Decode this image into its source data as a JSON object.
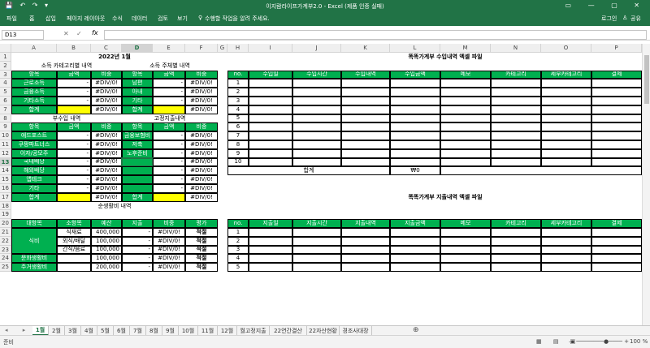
{
  "window": {
    "title": "이지람라이프가계부2.0 - Excel (제품 인증 실패)"
  },
  "ribbon": {
    "tabs": [
      "파일",
      "홈",
      "삽입",
      "페이지 레이아웃",
      "수식",
      "데이터",
      "검토",
      "보기"
    ],
    "tellme": "수행할 작업을 알려 주세요.",
    "login": "로그인",
    "share": "공유"
  },
  "formula": {
    "namebox": "D13",
    "fx": "fx",
    "value": ""
  },
  "columns": [
    "A",
    "B",
    "C",
    "D",
    "E",
    "F",
    "G",
    "H",
    "I",
    "J",
    "K",
    "L",
    "M",
    "N",
    "O",
    "P"
  ],
  "rows": [
    "1",
    "2",
    "3",
    "4",
    "5",
    "6",
    "7",
    "8",
    "9",
    "10",
    "11",
    "12",
    "13",
    "14",
    "15",
    "16",
    "17",
    "18",
    "19",
    "20",
    "21",
    "22",
    "23",
    "24",
    "25"
  ],
  "left": {
    "title": "2022년 1월",
    "sec1": "소득 카테고리별 내역",
    "sec2": "소득 주체별 내역",
    "h_item": "항목",
    "h_amt": "금액",
    "h_ratio": "비중",
    "inc_items": [
      "근로소득",
      "금융소득",
      "기타소득",
      "합계"
    ],
    "owner_items": [
      "남편",
      "아내",
      "기타",
      "합계"
    ],
    "dash": "-",
    "div": "#DIV/0!",
    "sec3": "부수입 내역",
    "sec4": "고정지출내역",
    "side_items": [
      "애드포스트",
      "쿠팡파트너스",
      "이자/공모주",
      "국내배당",
      "해외배당",
      "앱테크",
      "기타",
      "합계"
    ],
    "fixed_items": [
      "금융보험비",
      "저축",
      "노후준비"
    ],
    "sec5": "순생활비 내역",
    "h_big": "대항목",
    "h_small": "소항목",
    "h_budget": "예산",
    "h_spend": "지출",
    "h_eval": "평가",
    "living_big": [
      "식비",
      "문화생활비",
      "주거생활비"
    ],
    "living_small": [
      "식재료",
      "외식/배달",
      "간식/음료"
    ],
    "budgets": [
      "400,000",
      "100,000",
      "100,000",
      "100,000",
      "200,000"
    ],
    "eval": "적절"
  },
  "right": {
    "income_title": "똑똑가계부 수입내역 엑셀 파일",
    "income_headers": [
      "no.",
      "수입일",
      "수입시간",
      "수입내역",
      "수입금액",
      "메모",
      "카테고리",
      "세부카테고리",
      "결제"
    ],
    "nums": [
      "1",
      "2",
      "3",
      "4",
      "5",
      "6",
      "7",
      "8",
      "9",
      "10"
    ],
    "total_label": "합계",
    "total_value": "₩0",
    "expense_title": "똑똑가계부 지출내역 엑셀 파일",
    "expense_headers": [
      "no.",
      "지출일",
      "지출시간",
      "지출내역",
      "지출금액",
      "메모",
      "카테고리",
      "세부카테고리",
      "결제"
    ]
  },
  "sheets": [
    "1월",
    "2월",
    "3월",
    "4월",
    "5월",
    "6월",
    "7월",
    "8월",
    "9월",
    "10월",
    "11월",
    "12월",
    "월고정지출",
    "22연간결산",
    "22자산현황",
    "경조사대장"
  ],
  "status": {
    "ready": "준비",
    "zoom": "100 %"
  },
  "colors": {
    "accent": "#217346",
    "green": "#00b050",
    "yellow": "#ffff00"
  }
}
